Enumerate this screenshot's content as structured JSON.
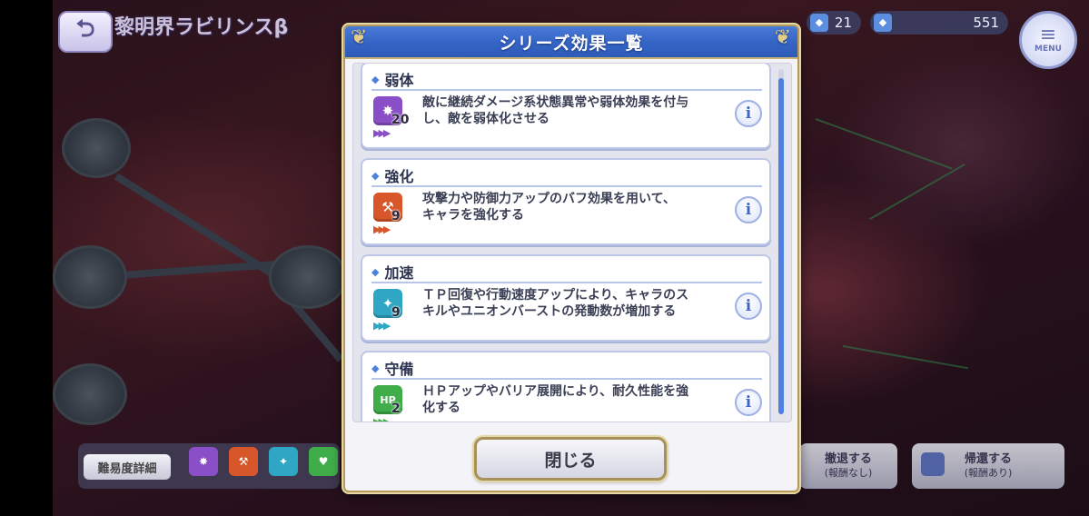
{
  "background": {
    "stage_title": "黎明界ラビリンスβ",
    "resources": [
      {
        "icon": "energy-icon",
        "value": "21"
      },
      {
        "icon": "currency-icon",
        "value": "551"
      }
    ],
    "menu_label": "MENU",
    "difficulty_button": "難易度詳細",
    "retreat_no_reward": {
      "title": "撤退する",
      "sub": "(報酬なし)"
    },
    "return_with_reward": {
      "title": "帰還する",
      "sub": "(報酬あり)"
    }
  },
  "modal": {
    "title": "シリーズ効果一覧",
    "close_label": "閉じる",
    "items": [
      {
        "name": "弱体",
        "count": "20",
        "color": "#8a4fc6",
        "desc": "敵に継続ダメージ系状態異常や弱体効果を付与\nし、敵を弱体化させる"
      },
      {
        "name": "強化",
        "count": "9",
        "color": "#d8572a",
        "desc": "攻撃力や防御力アップのバフ効果を用いて、\nキャラを強化する"
      },
      {
        "name": "加速",
        "count": "9",
        "color": "#2fa6c4",
        "desc": "ＴＰ回復や行動速度アップにより、キャラのス\nキルやユニオンバーストの発動数が増加する"
      },
      {
        "name": "守備",
        "count": "2",
        "color": "#3fae4a",
        "desc": "ＨＰアップやバリア展開により、耐久性能を強\n化する"
      }
    ]
  }
}
